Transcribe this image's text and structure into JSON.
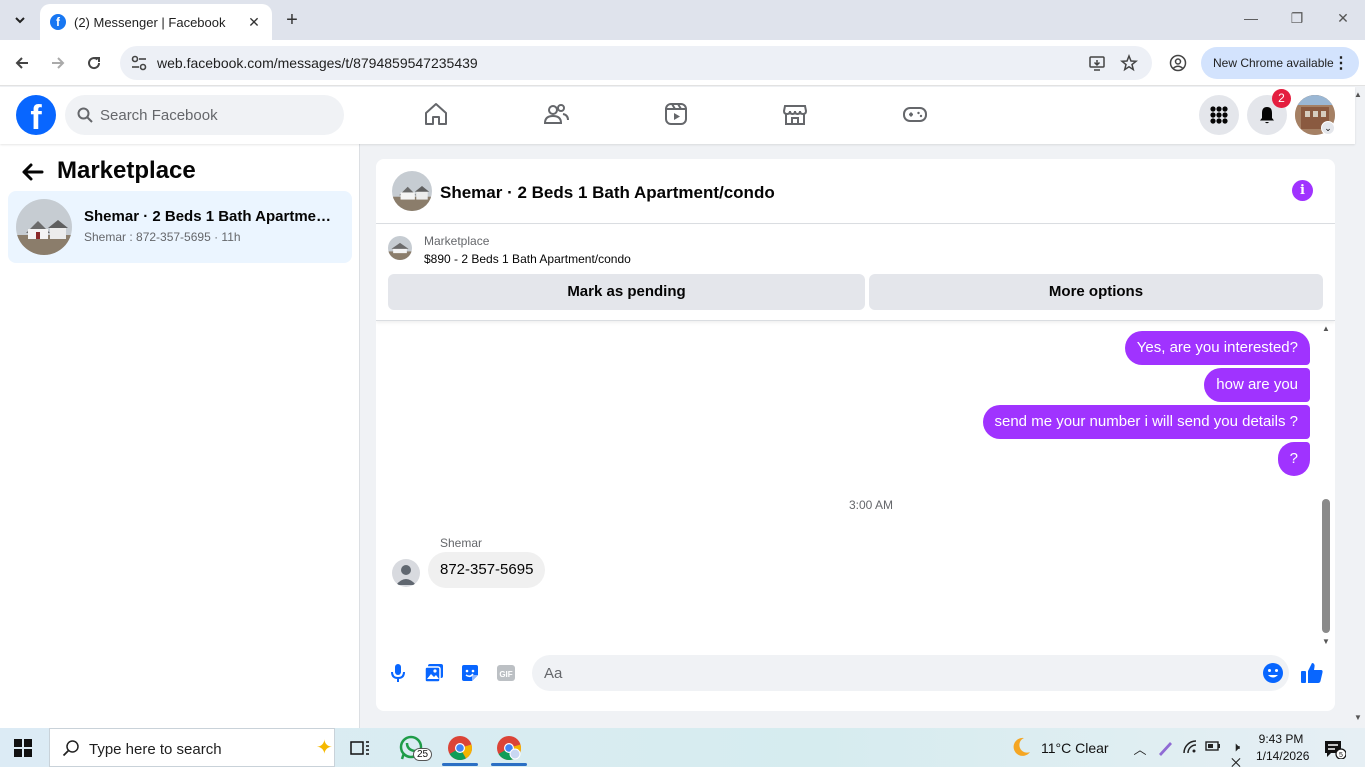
{
  "browser": {
    "tab_title": "(2) Messenger | Facebook",
    "url": "web.facebook.com/messages/t/8794859547235439",
    "update_label": "New Chrome available"
  },
  "facebook": {
    "search_placeholder": "Search Facebook",
    "notification_count": "2"
  },
  "left_panel": {
    "title": "Marketplace",
    "conversation": {
      "name": "Shemar · 2 Beds 1 Bath Apartment/condo",
      "preview": "Shemar : 872-357-5695 · 11h"
    }
  },
  "chat": {
    "title": "Shemar · 2 Beds 1 Bath Apartment/condo",
    "marketplace_label": "Marketplace",
    "listing": "$890 - 2 Beds 1 Bath Apartment/condo",
    "mark_pending_label": "Mark as pending",
    "more_options_label": "More options",
    "outgoing": [
      "Yes, are you interested?",
      "how are you",
      "send me your number i will send you details ?",
      "?"
    ],
    "timestamp": "3:00 AM",
    "incoming_sender": "Shemar",
    "incoming_message": "872-357-5695",
    "composer_placeholder": "Aa"
  },
  "taskbar": {
    "search_placeholder": "Type here to search",
    "whatsapp_badge": "25",
    "weather": "11°C  Clear",
    "time": "9:43 PM",
    "date": "1/14/2026",
    "notification_count": "5"
  },
  "colors": {
    "facebook_blue": "#0866ff",
    "messenger_purple": "#a033ff",
    "selected_row": "#ebf5ff"
  }
}
